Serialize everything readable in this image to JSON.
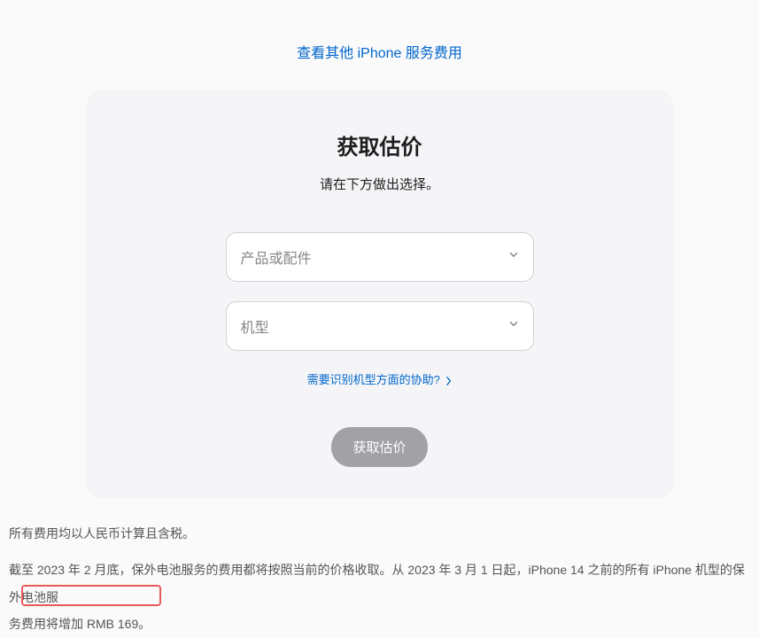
{
  "topLink": {
    "text": "查看其他 iPhone 服务费用"
  },
  "card": {
    "title": "获取估价",
    "subtitle": "请在下方做出选择。",
    "select1": {
      "placeholder": "产品或配件"
    },
    "select2": {
      "placeholder": "机型"
    },
    "helpLink": {
      "text": "需要识别机型方面的协助?"
    },
    "submitButton": {
      "label": "获取估价"
    }
  },
  "footer": {
    "line1": "所有费用均以人民币计算且含税。",
    "line2_part1": "截至 2023 年 2 月底，保外电池服务的费用都将按照当前的价格收取。从 2023 年 3 月 1 日起，iPhone 14 之前的所有 iPhone 机型的保外电池服",
    "line2_part2": "务费用将增加 RMB 169。"
  }
}
